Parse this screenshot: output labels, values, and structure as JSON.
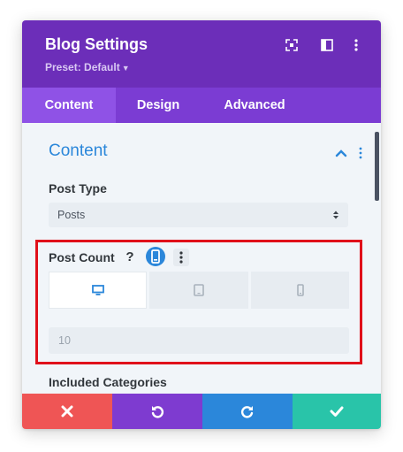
{
  "header": {
    "title": "Blog Settings",
    "preset_label": "Preset: Default",
    "icons": [
      "expand-icon",
      "sidebar-toggle-icon",
      "more-vertical-icon"
    ]
  },
  "tabs": [
    {
      "label": "Content",
      "active": true
    },
    {
      "label": "Design",
      "active": false
    },
    {
      "label": "Advanced",
      "active": false
    }
  ],
  "section": {
    "title": "Content",
    "expanded": true
  },
  "post_type": {
    "label": "Post Type",
    "value": "Posts"
  },
  "post_count": {
    "label": "Post Count",
    "help_glyph": "?",
    "devices": [
      {
        "name": "desktop",
        "active": true
      },
      {
        "name": "tablet",
        "active": false
      },
      {
        "name": "phone",
        "active": false
      }
    ],
    "value": "10"
  },
  "included_categories": {
    "label": "Included Categories"
  },
  "footer": {
    "buttons": [
      {
        "name": "discard",
        "icon": "close-icon",
        "color": "#ef5555"
      },
      {
        "name": "undo",
        "icon": "undo-icon",
        "color": "#7e3bd0"
      },
      {
        "name": "redo",
        "icon": "redo-icon",
        "color": "#2b87da"
      },
      {
        "name": "save",
        "icon": "check-icon",
        "color": "#29c4a9"
      }
    ]
  },
  "colors": {
    "header": "#6c2eb9",
    "tabs": "#7b3cd3",
    "active_tab": "#8f52e6",
    "accent_blue": "#2b87da",
    "highlight_border": "#e0101a"
  }
}
